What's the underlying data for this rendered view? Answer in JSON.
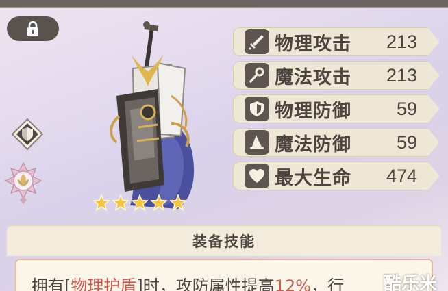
{
  "stats": [
    {
      "icon": "sword-icon",
      "label": "物理攻击",
      "value": "213"
    },
    {
      "icon": "magic-staff-icon",
      "label": "魔法攻击",
      "value": "213"
    },
    {
      "icon": "shield-icon",
      "label": "物理防御",
      "value": "59"
    },
    {
      "icon": "wizard-hat-icon",
      "label": "魔法防御",
      "value": "59"
    },
    {
      "icon": "heart-icon",
      "label": "最大生命",
      "value": "474"
    }
  ],
  "equipment": {
    "star_count": 5,
    "star_color": "#f5c542"
  },
  "skills": {
    "title": "装备技能",
    "desc_prefix": "拥有[",
    "desc_keyword": "物理护盾",
    "desc_middle": "]时，攻防属性提高",
    "desc_percent": "12%",
    "desc_suffix": "，行"
  },
  "watermark": "酷乐米",
  "colors": {
    "accent": "#d2574a",
    "stat_bg": "#efe7d6",
    "icon_bg": "#5e5450"
  }
}
